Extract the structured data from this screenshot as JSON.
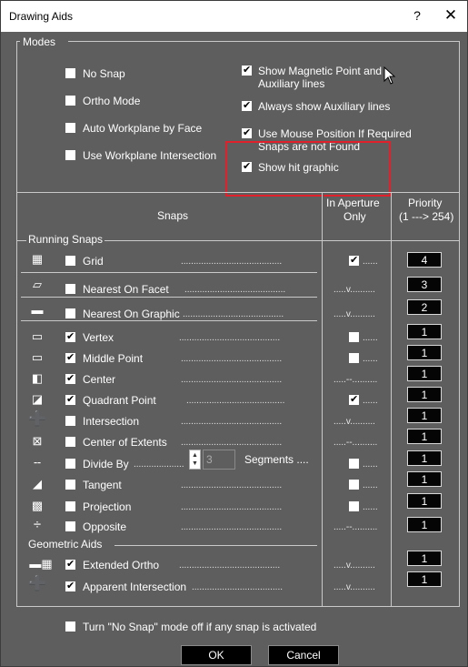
{
  "window": {
    "title": "Drawing Aids",
    "help": "?",
    "close": "✕"
  },
  "modes": {
    "label": "Modes",
    "no_snap": "No Snap",
    "ortho_mode": "Ortho Mode",
    "auto_workplane": "Auto Workplane by Face",
    "workplane_intersection": "Use Workplane Intersection",
    "magnetic_line1": "Show Magnetic Point and",
    "magnetic_line2": "Auxiliary lines",
    "always_aux": "Always show Auxiliary lines",
    "mouse_line1": "Use Mouse Position If Required",
    "mouse_line2": "Snaps are not Found",
    "hit_graphic": "Show hit graphic"
  },
  "headers": {
    "snaps": "Snaps",
    "aperture_line1": "In Aperture",
    "aperture_line2": "Only",
    "priority_line1": "Priority",
    "priority_line2": "(1 ---> 254)"
  },
  "groups": {
    "running": "Running Snaps",
    "geometric": "Geometric Aids"
  },
  "snaps": [
    {
      "label": "Grid",
      "checked": false,
      "aperture": "checked",
      "priority": "4"
    },
    {
      "label": "Nearest On Facet",
      "checked": false,
      "aperture": ".....v..........",
      "priority": "3"
    },
    {
      "label": "Nearest On Graphic",
      "checked": false,
      "aperture": ".....v..........",
      "priority": "2"
    },
    {
      "label": "Vertex",
      "checked": true,
      "aperture": "box",
      "priority": "1"
    },
    {
      "label": "Middle Point",
      "checked": true,
      "aperture": "box",
      "priority": "1"
    },
    {
      "label": "Center",
      "checked": true,
      "aperture": ".....--..........",
      "priority": "1"
    },
    {
      "label": "Quadrant Point",
      "checked": true,
      "aperture": "checked",
      "priority": "1"
    },
    {
      "label": "Intersection",
      "checked": false,
      "aperture": ".....v..........",
      "priority": "1"
    },
    {
      "label": "Center of Extents",
      "checked": false,
      "aperture": ".....--..........",
      "priority": "1"
    },
    {
      "label": "Divide By",
      "checked": false,
      "aperture": "box",
      "priority": "1"
    },
    {
      "label": "Tangent",
      "checked": false,
      "aperture": "box",
      "priority": "1"
    },
    {
      "label": "Projection",
      "checked": false,
      "aperture": "box",
      "priority": "1"
    },
    {
      "label": "Opposite",
      "checked": false,
      "aperture": ".....--..........",
      "priority": "1"
    },
    {
      "label": "Extended Ortho",
      "checked": true,
      "aperture": ".....v..........",
      "priority": "1"
    },
    {
      "label": "Apparent Intersection",
      "checked": true,
      "aperture": ".....v..........",
      "priority": "1"
    }
  ],
  "divide": {
    "value": "3",
    "segments": "Segments ...."
  },
  "footer": {
    "turn_off": "Turn \"No Snap\" mode off if any snap is activated",
    "ok": "OK",
    "cancel": "Cancel"
  },
  "icons": [
    "grid-icon",
    "nearest-facet-icon",
    "nearest-graphic-icon",
    "vertex-icon",
    "middle-point-icon",
    "center-icon",
    "quadrant-icon",
    "intersection-icon",
    "center-extents-icon",
    "divide-icon",
    "tangent-icon",
    "projection-icon",
    "opposite-icon",
    "extended-ortho-icon",
    "apparent-intersection-icon"
  ],
  "colors": {
    "background": "#5e5e5e",
    "highlight": "#e0202a",
    "priority_box": "#050505"
  }
}
